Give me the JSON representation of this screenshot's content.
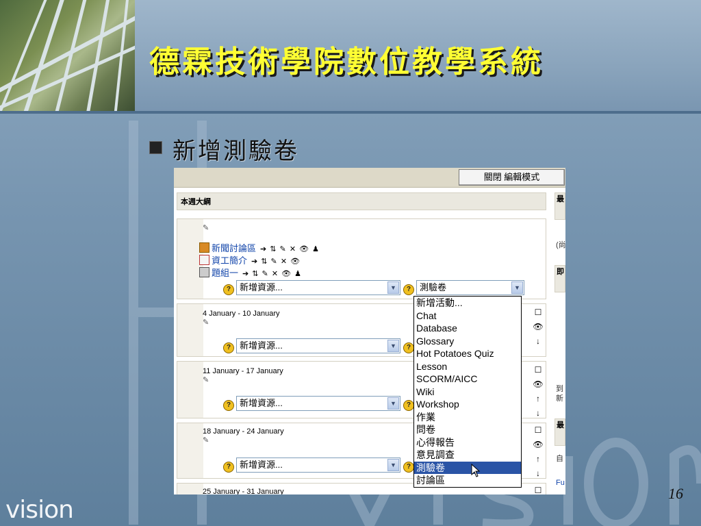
{
  "slide": {
    "title": "德霖技術學院數位教學系統",
    "bullet": "新增測驗卷",
    "page_number": "16",
    "logo_text": "vision"
  },
  "moodle": {
    "edit_button": "關閉 編輯模式",
    "weekly_outline": "本週大綱",
    "topic0_activities": [
      {
        "label": "新聞討論區",
        "icon": "forum-icon",
        "controls": "➔ ⇅ ✎ ✕ 👁 ♟"
      },
      {
        "label": "資工簡介",
        "icon": "resource-icon",
        "controls": "➔ ⇅ ✎ ✕ 👁"
      },
      {
        "label": "題組一",
        "icon": "quiz-icon",
        "controls": "➔ ⇅ ✎ ✕ 👁 ♟"
      }
    ],
    "add_resource_label": "新增資源...",
    "add_activity_label": "測驗卷",
    "weeks": [
      {
        "date": "4 January - 10 January"
      },
      {
        "date": "11 January - 17 January"
      },
      {
        "date": "18 January - 24 January"
      },
      {
        "date": "25 January - 31 January"
      }
    ],
    "activity_options": [
      "新增活動...",
      "Chat",
      "Database",
      "Glossary",
      "Hot Potatoes Quiz",
      "Lesson",
      "SCORM/AICC",
      "Wiki",
      "Workshop",
      "作業",
      "問卷",
      "心得報告",
      "意見調查",
      "測驗卷",
      "討論區"
    ],
    "selected_option": "測驗卷",
    "side_block_labels": [
      "最",
      "即",
      "最"
    ],
    "side_texts": [
      "(尚",
      "到",
      "新",
      "自",
      "Fu"
    ]
  }
}
